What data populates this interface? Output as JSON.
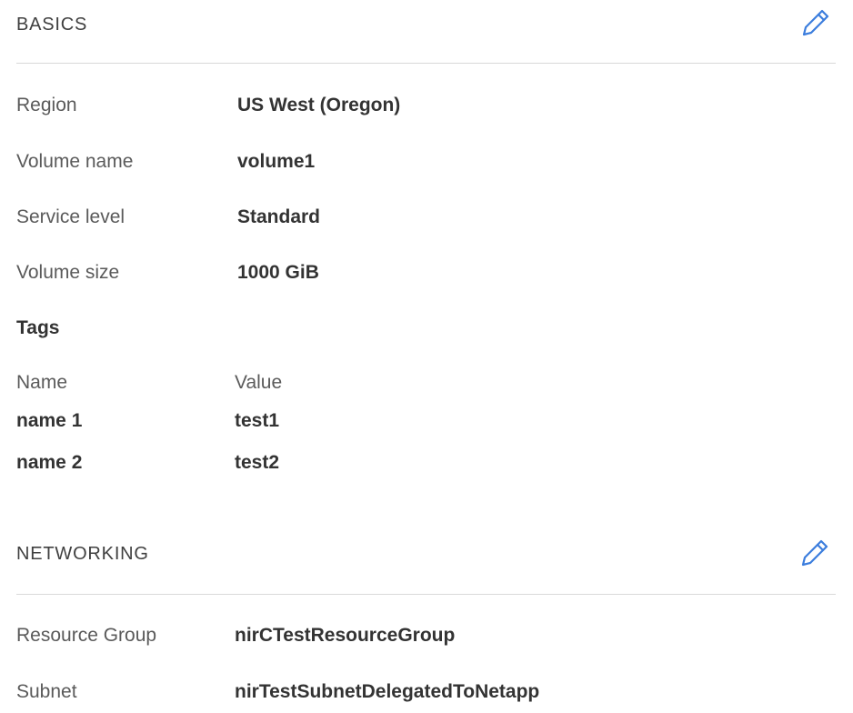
{
  "basics": {
    "title": "BASICS",
    "edit_icon": "pencil-icon",
    "rows": [
      {
        "label": "Region",
        "value": "US West (Oregon)"
      },
      {
        "label": "Volume name",
        "value": "volume1"
      },
      {
        "label": "Service level",
        "value": "Standard"
      },
      {
        "label": "Volume size",
        "value": "1000 GiB"
      }
    ],
    "tags": {
      "heading": "Tags",
      "name_header": "Name",
      "value_header": "Value",
      "items": [
        {
          "name": "name 1",
          "value": "test1"
        },
        {
          "name": "name 2",
          "value": "test2"
        }
      ]
    }
  },
  "networking": {
    "title": "NETWORKING",
    "edit_icon": "pencil-icon",
    "rows": [
      {
        "label": "Resource Group",
        "value": "nirCTestResourceGroup"
      },
      {
        "label": "Subnet",
        "value": "nirTestSubnetDelegatedToNetapp"
      }
    ]
  },
  "colors": {
    "accent": "#3b7ddd",
    "divider": "#d9d9d9"
  }
}
